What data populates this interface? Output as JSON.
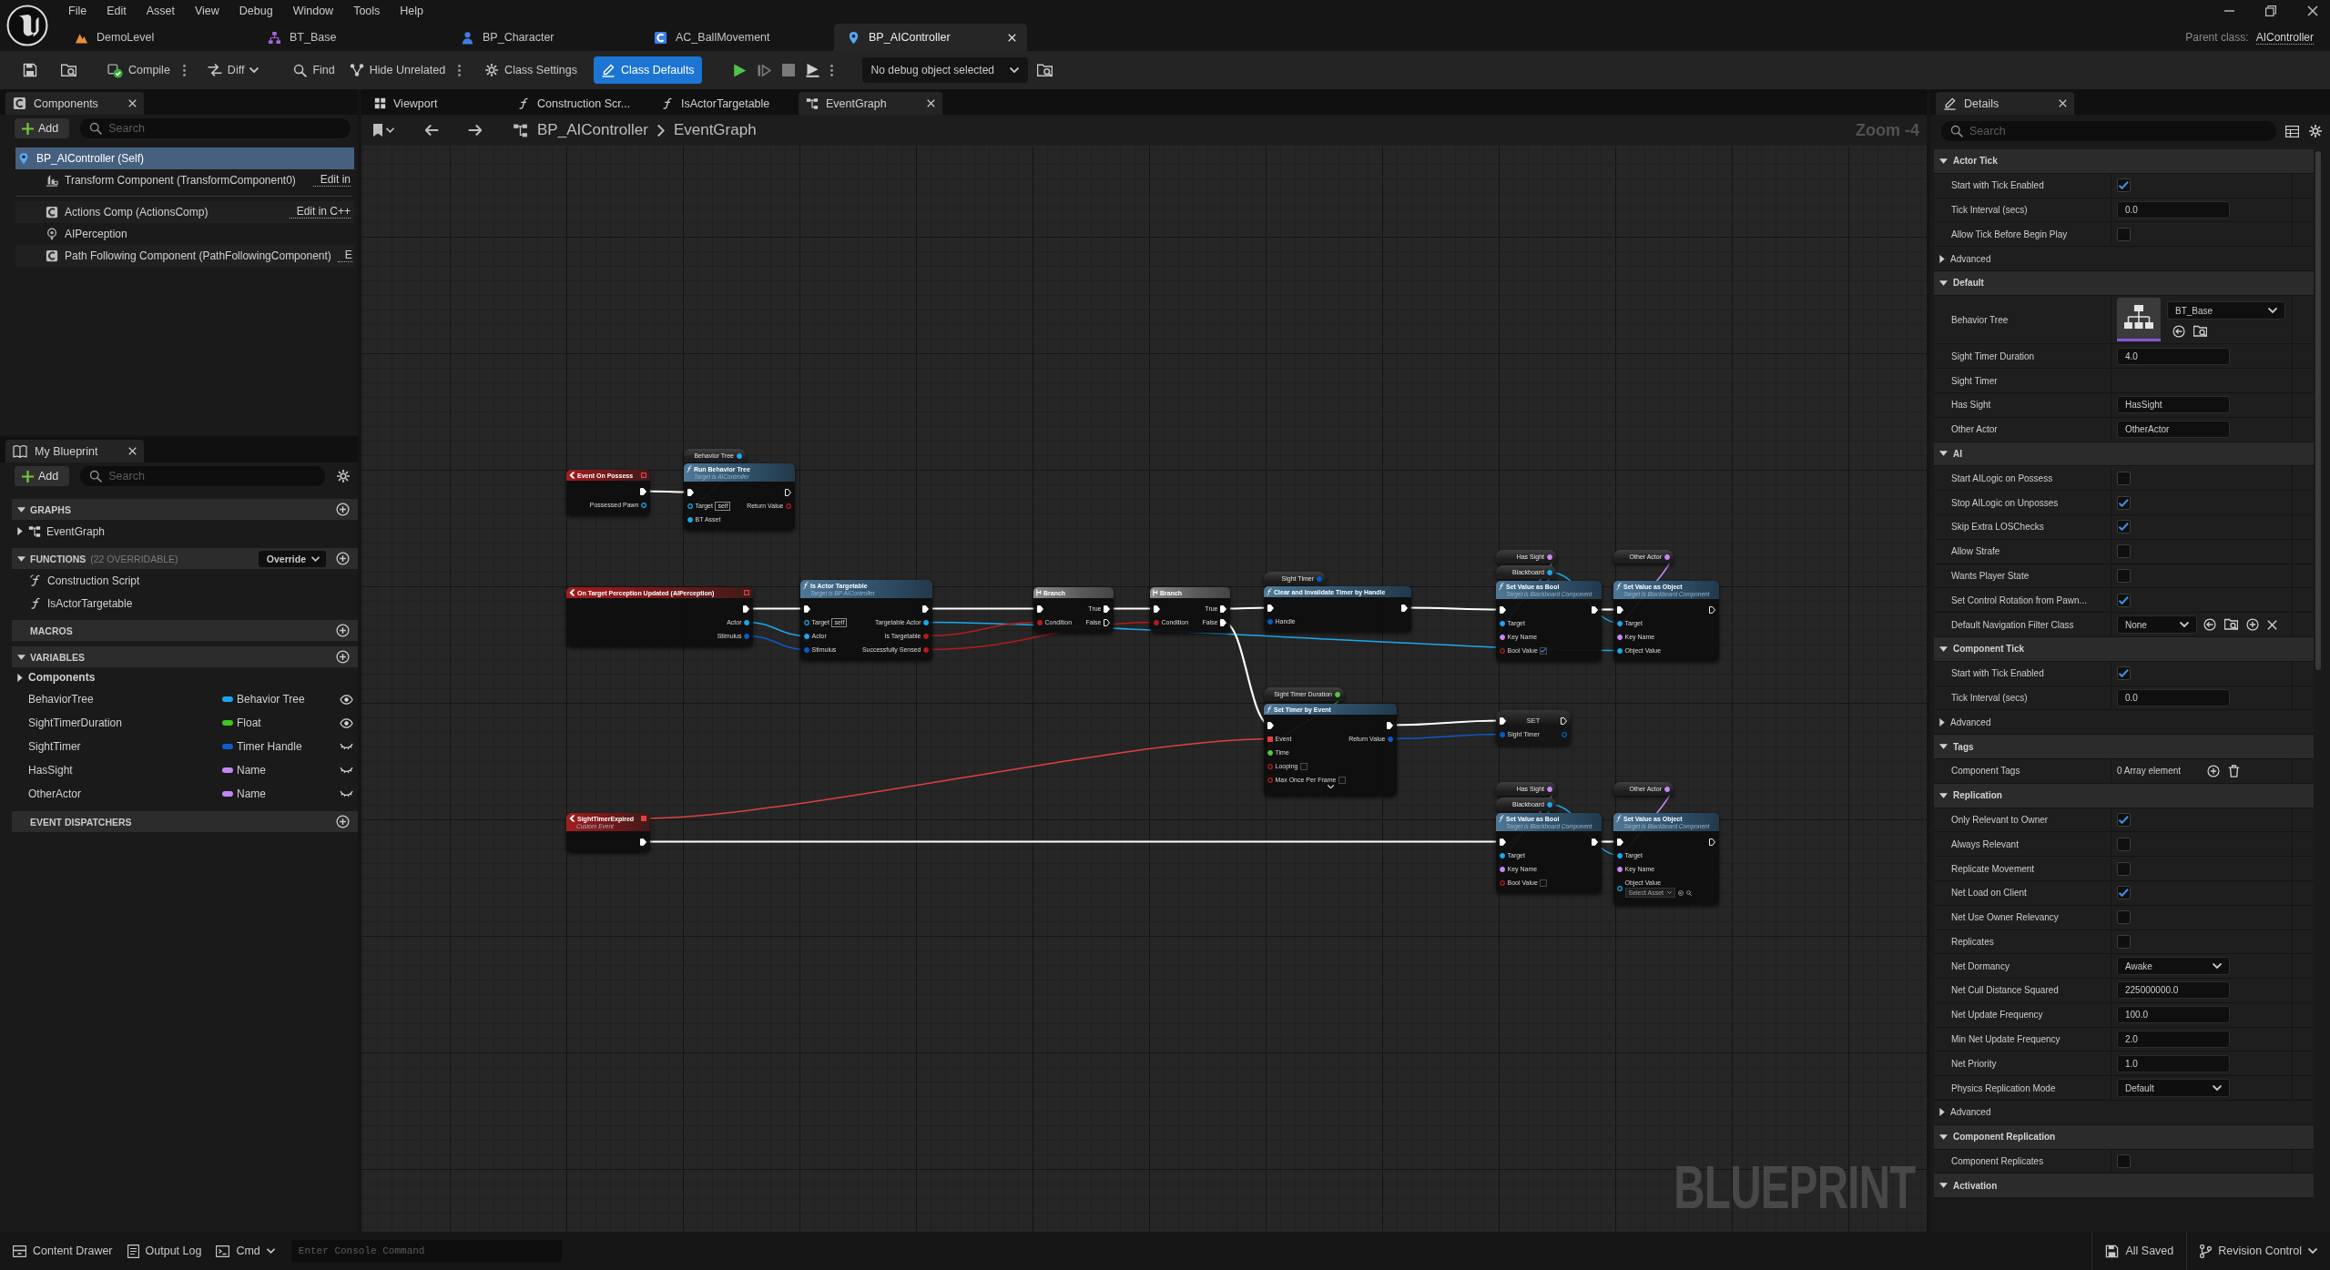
{
  "menu": [
    "File",
    "Edit",
    "Asset",
    "View",
    "Debug",
    "Window",
    "Tools",
    "Help"
  ],
  "asset_tabs": [
    {
      "label": "DemoLevel",
      "kind": "level",
      "selected": false
    },
    {
      "label": "BT_Base",
      "kind": "behavior_tree",
      "selected": false
    },
    {
      "label": "BP_Character",
      "kind": "character",
      "selected": false
    },
    {
      "label": "AC_BallMovement",
      "kind": "component",
      "selected": false
    },
    {
      "label": "BP_AIController",
      "kind": "controller",
      "selected": true
    }
  ],
  "parent_class": {
    "label": "Parent class:",
    "value": "AIController"
  },
  "toolbar": {
    "compile": "Compile",
    "diff": "Diff",
    "find": "Find",
    "hide_unrelated": "Hide Unrelated",
    "class_settings": {
      "label": "Class Settings",
      "selected": false
    },
    "class_defaults": {
      "label": "Class Defaults",
      "selected": true
    },
    "debug_object": "No debug object selected"
  },
  "components": {
    "tab": "Components",
    "add": "Add",
    "search_placeholder": "Search",
    "tree": [
      {
        "label": "BP_AIController (Self)",
        "kind": "controller",
        "selected": true,
        "children": [
          {
            "label": "Transform Component (TransformComponent0)",
            "kind": "transform",
            "selected": false,
            "link": "Edit in"
          }
        ]
      }
    ],
    "others": [
      {
        "label": "Actions Comp (ActionsComp)",
        "kind": "component",
        "selected": false,
        "link": "Edit in C++"
      },
      {
        "label": "AIPerception",
        "kind": "perception",
        "selected": false
      },
      {
        "label": "Path Following Component (PathFollowingComponent)",
        "kind": "component",
        "selected": false,
        "link": "E"
      }
    ]
  },
  "my_blueprint": {
    "tab": "My Blueprint",
    "add": "Add",
    "search_placeholder": "Search",
    "sections": [
      {
        "title": "GRAPHS",
        "expanded": true,
        "items": [
          {
            "label": "EventGraph",
            "kind": "graph",
            "expanded": false
          }
        ]
      },
      {
        "title": "FUNCTIONS",
        "note": "(22 OVERRIDABLE)",
        "override": "Override",
        "expanded": true,
        "items": [
          {
            "label": "Construction Script",
            "kind": "construction"
          },
          {
            "label": "IsActorTargetable",
            "kind": "function"
          }
        ]
      },
      {
        "title": "MACROS"
      },
      {
        "title": "VARIABLES",
        "expanded": true,
        "items": [
          {
            "label": "Components",
            "kind": "category",
            "expanded": false
          },
          {
            "label": "BehaviorTree",
            "kind": "variable",
            "type": "Behavior Tree",
            "color": "#1aa6ee",
            "exposed": true
          },
          {
            "label": "SightTimerDuration",
            "kind": "variable",
            "type": "Float",
            "color": "#3fc41f",
            "exposed": true
          },
          {
            "label": "SightTimer",
            "kind": "variable",
            "type": "Timer Handle",
            "color": "#0b5fd1",
            "exposed": false
          },
          {
            "label": "HasSight",
            "kind": "variable",
            "type": "Name",
            "color": "#c486f5",
            "exposed": false
          },
          {
            "label": "OtherActor",
            "kind": "variable",
            "type": "Name",
            "color": "#c486f5",
            "exposed": false
          }
        ]
      },
      {
        "title": "EVENT DISPATCHERS"
      }
    ]
  },
  "graph_tabs": [
    {
      "label": "Viewport",
      "kind": "viewport",
      "selected": false
    },
    {
      "label": "Construction Scr...",
      "kind": "function",
      "selected": false
    },
    {
      "label": "IsActorTargetable",
      "kind": "function",
      "selected": false
    },
    {
      "label": "EventGraph",
      "kind": "graph",
      "selected": true
    }
  ],
  "graph": {
    "breadcrumb": [
      "BP_AIController",
      "EventGraph"
    ],
    "zoom": "Zoom -4",
    "corner_label": "BLUEPRINT",
    "nodes": [
      {
        "kind": "event",
        "title": "Event On Possess",
        "delegate_connected": false,
        "outputs": [
          {
            "kind": "exec",
            "connected": true
          },
          {
            "label": "Possessed Pawn",
            "kind": "object",
            "connected": false
          }
        ]
      },
      {
        "kind": "getter",
        "label": "Behavior Tree",
        "pin": {
          "kind": "object",
          "connected": true
        }
      },
      {
        "kind": "function",
        "title": "Run Behavior Tree",
        "subtitle": "Target is AIController",
        "inputs": [
          {
            "kind": "exec",
            "connected": true
          },
          {
            "label": "Target",
            "kind": "object",
            "connected": false,
            "value": "self"
          },
          {
            "label": "BT Asset",
            "kind": "object",
            "connected": true
          }
        ],
        "outputs": [
          {
            "kind": "exec",
            "connected": false
          },
          {
            "label": "Return Value",
            "kind": "bool",
            "connected": false
          }
        ]
      },
      {
        "kind": "event",
        "title": "On Target Perception Updated (AIPerception)",
        "delegate_connected": false,
        "outputs": [
          {
            "kind": "exec",
            "connected": true
          },
          {
            "label": "Actor",
            "kind": "object",
            "connected": true
          },
          {
            "label": "Stimulus",
            "kind": "struct",
            "connected": true
          }
        ]
      },
      {
        "kind": "function",
        "title": "Is Actor Targetable",
        "subtitle": "Target is BP AIController",
        "inputs": [
          {
            "kind": "exec",
            "connected": true
          },
          {
            "label": "Target",
            "kind": "object",
            "connected": false,
            "value": "self"
          },
          {
            "label": "Actor",
            "kind": "object",
            "connected": true
          },
          {
            "label": "Stimulus",
            "kind": "struct",
            "connected": true
          }
        ],
        "outputs": [
          {
            "kind": "exec",
            "connected": true
          },
          {
            "label": "Targetable Actor",
            "kind": "object",
            "connected": true
          },
          {
            "label": "Is Targetable",
            "kind": "bool",
            "connected": true
          },
          {
            "label": "Successfully Sensed",
            "kind": "bool",
            "connected": true
          }
        ]
      },
      {
        "kind": "branch",
        "title": "Branch",
        "inputs": [
          {
            "kind": "exec",
            "connected": true
          },
          {
            "label": "Condition",
            "kind": "bool",
            "connected": true
          }
        ],
        "outputs": [
          {
            "label": "True",
            "kind": "exec",
            "connected": true
          },
          {
            "label": "False",
            "kind": "exec",
            "connected": false
          }
        ]
      },
      {
        "kind": "branch",
        "title": "Branch",
        "inputs": [
          {
            "kind": "exec",
            "connected": true
          },
          {
            "label": "Condition",
            "kind": "bool",
            "connected": true
          }
        ],
        "outputs": [
          {
            "label": "True",
            "kind": "exec",
            "connected": true
          },
          {
            "label": "False",
            "kind": "exec",
            "connected": true
          }
        ]
      },
      {
        "kind": "event",
        "title": "SightTimerExpired",
        "subtitle": "Custom Event",
        "delegate_connected": true,
        "outputs": [
          {
            "kind": "exec",
            "connected": true
          }
        ]
      },
      {
        "kind": "getter",
        "label": "Sight Timer",
        "pin": {
          "kind": "struct",
          "connected": true
        }
      },
      {
        "kind": "function",
        "title": "Clear and Invalidate Timer by Handle",
        "inputs": [
          {
            "kind": "exec",
            "connected": true
          },
          {
            "label": "Handle",
            "kind": "struct",
            "connected": true
          }
        ],
        "outputs": [
          {
            "kind": "exec",
            "connected": true
          }
        ]
      },
      {
        "kind": "getter",
        "label": "Has Sight",
        "pin": {
          "kind": "name",
          "connected": true
        }
      },
      {
        "kind": "getter",
        "label": "Blackboard",
        "pin": {
          "kind": "object",
          "connected": true
        }
      },
      {
        "kind": "function",
        "title": "Set Value as Bool",
        "subtitle": "Target is Blackboard Component",
        "inputs": [
          {
            "kind": "exec",
            "connected": true
          },
          {
            "label": "Target",
            "kind": "object",
            "connected": true
          },
          {
            "label": "Key Name",
            "kind": "name",
            "connected": true
          },
          {
            "label": "Bool Value",
            "kind": "bool",
            "connected": false,
            "checked": true
          }
        ],
        "outputs": [
          {
            "kind": "exec",
            "connected": true
          }
        ]
      },
      {
        "kind": "getter",
        "label": "Other Actor",
        "pin": {
          "kind": "name",
          "connected": true
        }
      },
      {
        "kind": "function",
        "title": "Set Value as Object",
        "subtitle": "Target is Blackboard Component",
        "inputs": [
          {
            "kind": "exec",
            "connected": true
          },
          {
            "label": "Target",
            "kind": "object",
            "connected": true
          },
          {
            "label": "Key Name",
            "kind": "name",
            "connected": true
          },
          {
            "label": "Object Value",
            "kind": "object",
            "connected": true
          }
        ],
        "outputs": [
          {
            "kind": "exec",
            "connected": false
          }
        ]
      },
      {
        "kind": "getter",
        "label": "Sight Timer Duration",
        "pin": {
          "kind": "float",
          "connected": true
        }
      },
      {
        "kind": "function",
        "title": "Set Timer by Event",
        "advanced_collapsed": true,
        "inputs": [
          {
            "kind": "exec",
            "connected": true
          },
          {
            "label": "Event",
            "kind": "delegate",
            "connected": true
          },
          {
            "label": "Time",
            "kind": "float",
            "connected": true
          },
          {
            "label": "Looping",
            "kind": "bool",
            "connected": false,
            "checked": false
          },
          {
            "label": "Max Once Per Frame",
            "kind": "bool",
            "connected": false,
            "checked": false
          }
        ],
        "outputs": [
          {
            "kind": "exec",
            "connected": true
          },
          {
            "label": "Return Value",
            "kind": "struct",
            "connected": true
          }
        ]
      },
      {
        "kind": "set",
        "title": "SET",
        "inputs": [
          {
            "kind": "exec",
            "connected": true
          },
          {
            "label": "Sight Timer",
            "kind": "struct",
            "connected": true
          }
        ],
        "outputs": [
          {
            "kind": "exec",
            "connected": false
          },
          {
            "kind": "struct",
            "connected": false
          }
        ]
      },
      {
        "kind": "getter",
        "label": "Has Sight",
        "pin": {
          "kind": "name",
          "connected": true
        }
      },
      {
        "kind": "getter",
        "label": "Blackboard",
        "pin": {
          "kind": "object",
          "connected": true
        }
      },
      {
        "kind": "function",
        "title": "Set Value as Bool",
        "subtitle": "Target is Blackboard Component",
        "inputs": [
          {
            "kind": "exec",
            "connected": true
          },
          {
            "label": "Target",
            "kind": "object",
            "connected": true
          },
          {
            "label": "Key Name",
            "kind": "name",
            "connected": true
          },
          {
            "label": "Bool Value",
            "kind": "bool",
            "connected": false,
            "checked": false
          }
        ],
        "outputs": [
          {
            "kind": "exec",
            "connected": true
          }
        ]
      },
      {
        "kind": "getter",
        "label": "Other Actor",
        "pin": {
          "kind": "name",
          "connected": true
        }
      },
      {
        "kind": "function",
        "title": "Set Value as Object",
        "subtitle": "Target is Blackboard Component",
        "inputs": [
          {
            "kind": "exec",
            "connected": true
          },
          {
            "label": "Target",
            "kind": "object",
            "connected": true
          },
          {
            "label": "Key Name",
            "kind": "name",
            "connected": true
          },
          {
            "label": "Object Value",
            "kind": "object",
            "connected": false,
            "asset_picker": "Select Asset"
          }
        ],
        "outputs": [
          {
            "kind": "exec",
            "connected": false
          }
        ]
      }
    ]
  },
  "details": {
    "tab": "Details",
    "search_placeholder": "Search",
    "categories": [
      {
        "title": "Actor Tick",
        "expanded": true,
        "rows": [
          {
            "label": "Start with Tick Enabled",
            "kind": "checkbox",
            "checked": true
          },
          {
            "label": "Tick Interval (secs)",
            "kind": "number",
            "value": "0.0"
          },
          {
            "label": "Allow Tick Before Begin Play",
            "kind": "checkbox",
            "checked": false
          },
          {
            "label": "Advanced",
            "kind": "expander",
            "expanded": false
          }
        ]
      },
      {
        "title": "Default",
        "expanded": true,
        "rows": [
          {
            "label": "Behavior Tree",
            "kind": "asset",
            "value": "BT_Base"
          },
          {
            "label": "Sight Timer Duration",
            "kind": "number",
            "value": "4.0"
          },
          {
            "label": "Sight Timer",
            "kind": "empty"
          },
          {
            "label": "Has Sight",
            "kind": "text",
            "value": "HasSight"
          },
          {
            "label": "Other Actor",
            "kind": "text",
            "value": "OtherActor"
          }
        ]
      },
      {
        "title": "AI",
        "expanded": true,
        "rows": [
          {
            "label": "Start AILogic on Possess",
            "kind": "checkbox",
            "checked": false
          },
          {
            "label": "Stop AILogic on Unposses",
            "kind": "checkbox",
            "checked": true
          },
          {
            "label": "Skip Extra LOSChecks",
            "kind": "checkbox",
            "checked": true
          },
          {
            "label": "Allow Strafe",
            "kind": "checkbox",
            "checked": false
          },
          {
            "label": "Wants Player State",
            "kind": "checkbox",
            "checked": false
          },
          {
            "label": "Set Control Rotation from Pawn...",
            "kind": "checkbox",
            "checked": true
          },
          {
            "label": "Default Navigation Filter Class",
            "kind": "class",
            "value": "None"
          }
        ]
      },
      {
        "title": "Component Tick",
        "expanded": true,
        "rows": [
          {
            "label": "Start with Tick Enabled",
            "kind": "checkbox",
            "checked": true
          },
          {
            "label": "Tick Interval (secs)",
            "kind": "number",
            "value": "0.0"
          },
          {
            "label": "Advanced",
            "kind": "expander",
            "expanded": false
          }
        ]
      },
      {
        "title": "Tags",
        "expanded": true,
        "rows": [
          {
            "label": "Component Tags",
            "kind": "array",
            "value": "0 Array element"
          }
        ]
      },
      {
        "title": "Replication",
        "expanded": true,
        "rows": [
          {
            "label": "Only Relevant to Owner",
            "kind": "checkbox",
            "checked": true
          },
          {
            "label": "Always Relevant",
            "kind": "checkbox",
            "checked": false
          },
          {
            "label": "Replicate Movement",
            "kind": "checkbox",
            "checked": false
          },
          {
            "label": "Net Load on Client",
            "kind": "checkbox",
            "checked": true
          },
          {
            "label": "Net Use Owner Relevancy",
            "kind": "checkbox",
            "checked": false
          },
          {
            "label": "Replicates",
            "kind": "checkbox",
            "checked": false
          },
          {
            "label": "Net Dormancy",
            "kind": "dropdown",
            "value": "Awake"
          },
          {
            "label": "Net Cull Distance Squared",
            "kind": "number",
            "value": "225000000.0"
          },
          {
            "label": "Net Update Frequency",
            "kind": "number",
            "value": "100.0"
          },
          {
            "label": "Min Net Update Frequency",
            "kind": "number",
            "value": "2.0"
          },
          {
            "label": "Net Priority",
            "kind": "number",
            "value": "1.0"
          },
          {
            "label": "Physics Replication Mode",
            "kind": "dropdown",
            "value": "Default"
          },
          {
            "label": "Advanced",
            "kind": "expander",
            "expanded": false
          }
        ]
      },
      {
        "title": "Component Replication",
        "expanded": true,
        "rows": [
          {
            "label": "Component Replicates",
            "kind": "checkbox",
            "checked": false
          }
        ]
      },
      {
        "title": "Activation",
        "expanded": true
      }
    ]
  },
  "status_bar": {
    "content_drawer": "Content Drawer",
    "output_log": "Output Log",
    "cmd": "Cmd",
    "console_placeholder": "Enter Console Command",
    "save_state": "All Saved",
    "revision_control": "Revision Control"
  }
}
